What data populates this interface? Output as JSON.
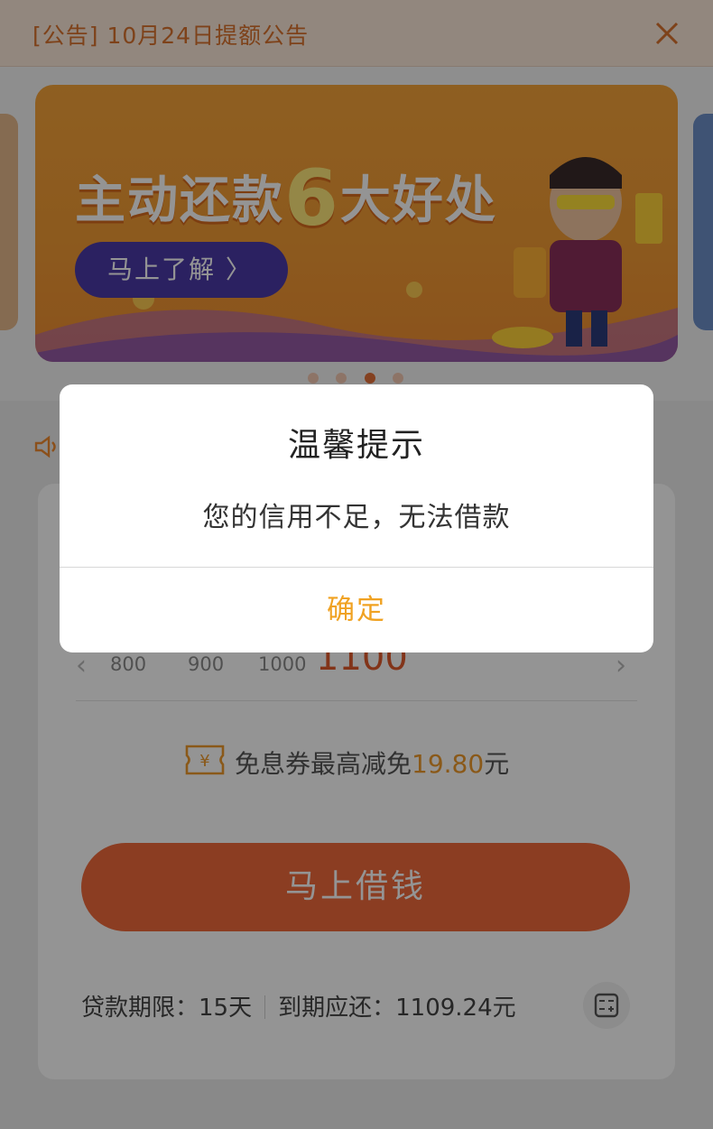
{
  "notice": {
    "text": "[公告] 10月24日提额公告",
    "close_icon": "close-icon"
  },
  "banner": {
    "title_part1": "主动还款",
    "title_number": "6",
    "title_part2": "大好处",
    "button_label": "马上了解 〉",
    "carousel_dots": 4,
    "active_dot": 3
  },
  "amount_scale": {
    "values": [
      "800",
      "900",
      "1000",
      "1100"
    ],
    "selected": "1100"
  },
  "coupon": {
    "icon": "yuan-ticket-icon",
    "text": "免息券最高减免",
    "amount": "19.80",
    "unit": "元"
  },
  "borrow_button": {
    "label": "马上借钱"
  },
  "summary": {
    "term_label": "贷款期限：",
    "term_value": "15天",
    "repay_label": "到期应还：",
    "repay_value": "1109.24元",
    "calculator_icon": "calculator-icon"
  },
  "dialog": {
    "title": "温馨提示",
    "message": "您的信用不足，无法借款",
    "confirm_label": "确定"
  },
  "colors": {
    "accent_orange": "#f06a3b",
    "confirm_yellow": "#f0a222",
    "notice_text": "#d9722d"
  }
}
